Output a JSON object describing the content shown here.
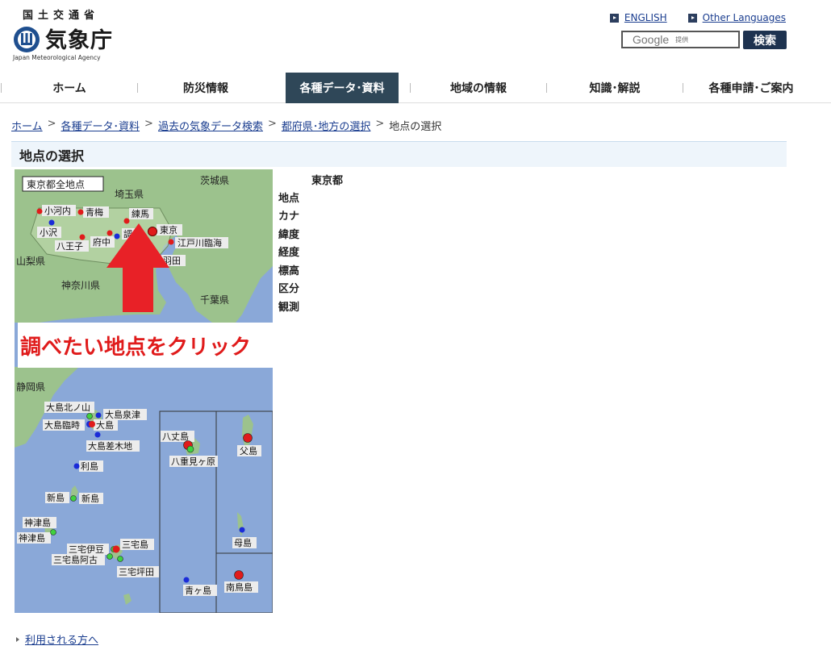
{
  "header": {
    "logo_top": "国土交通省",
    "logo_name": "気象庁",
    "logo_en": "Japan Meteorological Agency",
    "lang_english": "ENGLISH",
    "lang_other": "Other Languages",
    "search_logo": "Google",
    "search_sub": "提供",
    "search_button": "検索"
  },
  "nav": [
    "ホーム",
    "防災情報",
    "各種データ･資料",
    "地域の情報",
    "知識･解説",
    "各種申請･ご案内"
  ],
  "breadcrumb": [
    "ホーム",
    "各種データ･資料",
    "過去の気象データ検索",
    "都府県･地方の選択",
    "地点の選択"
  ],
  "page_title": "地点の選択",
  "map": {
    "all_points_button": "東京都全地点",
    "prefs": [
      "茨城県",
      "埼玉県",
      "山梨県",
      "神奈川県",
      "千葉県",
      "静岡県"
    ],
    "stations_main": [
      "小河内",
      "青梅",
      "練馬",
      "東京",
      "小沢",
      "八王子",
      "府中",
      "調",
      "江戸川臨海",
      "羽田"
    ],
    "stations_islands": [
      "大島北ノ山",
      "大島泉津",
      "大島臨時",
      "大島",
      "大島差木地",
      "利島",
      "新島",
      "新島",
      "神津島",
      "神津島",
      "三宅伊豆",
      "三宅島",
      "三宅島阿古",
      "三宅坪田",
      "八丈島",
      "八重見ヶ原",
      "父島",
      "母島",
      "青ヶ島",
      "南鳥島"
    ],
    "callout": "調べたい地点をクリック"
  },
  "info": {
    "prefecture": "東京都",
    "fields": [
      "地点",
      "カナ",
      "緯度",
      "経度",
      "標高",
      "区分",
      "観測"
    ]
  },
  "footer": {
    "link": "利用される方へ"
  },
  "colors": {
    "nav_active": "#2f4758",
    "sea": "#8aa8d8",
    "land": "#9cc28d",
    "callout_text": "#e01b1b"
  }
}
